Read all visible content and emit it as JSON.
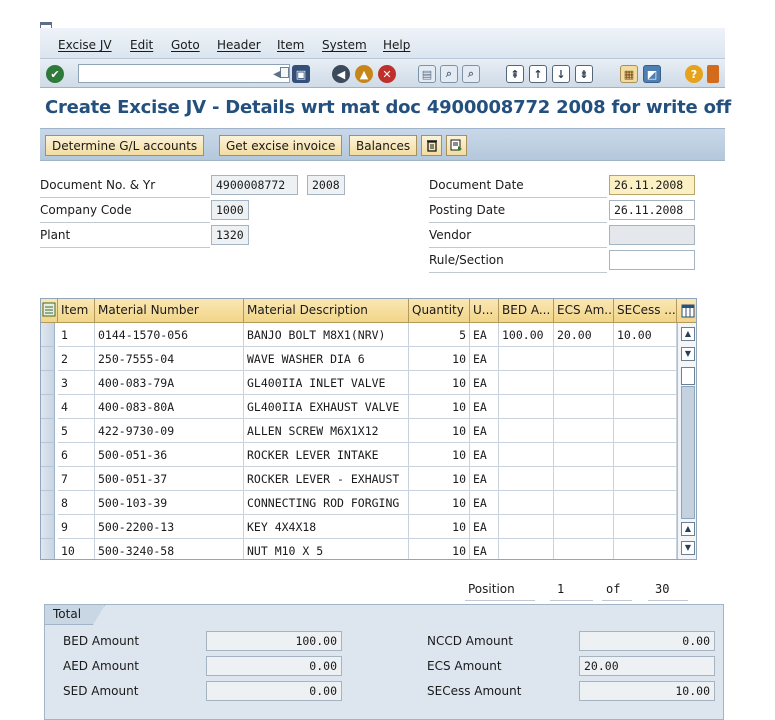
{
  "menu": [
    "Excise JV",
    "Edit",
    "Goto",
    "Header",
    "Item",
    "System",
    "Help"
  ],
  "title": "Create Excise JV - Details wrt mat doc 4900008772 2008 for write off",
  "app_buttons": {
    "determine": "Determine G/L accounts",
    "get_invoice": "Get excise invoice",
    "balances": "Balances"
  },
  "header": {
    "doc_no_label": "Document No. & Yr",
    "doc_no": "4900008772",
    "doc_year": "2008",
    "company_code_label": "Company Code",
    "company_code": "1000",
    "plant_label": "Plant",
    "plant": "1320",
    "doc_date_label": "Document Date",
    "doc_date": "26.11.2008",
    "posting_date_label": "Posting Date",
    "posting_date": "26.11.2008",
    "vendor_label": "Vendor",
    "vendor": "",
    "rule_label": "Rule/Section",
    "rule": ""
  },
  "table": {
    "columns": [
      "Item",
      "Material Number",
      "Material Description",
      "Quantity",
      "U...",
      "BED A...",
      "ECS Am...",
      "SECess ..."
    ],
    "rows": [
      {
        "item": "1",
        "mat": "0144-1570-056",
        "desc": "BANJO BOLT M8X1(NRV)",
        "qty": "5",
        "uom": "EA",
        "bed": "100.00",
        "ecs": "20.00",
        "secess": "10.00"
      },
      {
        "item": "2",
        "mat": "250-7555-04",
        "desc": "WAVE WASHER DIA 6",
        "qty": "10",
        "uom": "EA",
        "bed": "",
        "ecs": "",
        "secess": ""
      },
      {
        "item": "3",
        "mat": "400-083-79A",
        "desc": "GL400IIA  INLET VALVE",
        "qty": "10",
        "uom": "EA",
        "bed": "",
        "ecs": "",
        "secess": ""
      },
      {
        "item": "4",
        "mat": "400-083-80A",
        "desc": "GL400IIA EXHAUST VALVE",
        "qty": "10",
        "uom": "EA",
        "bed": "",
        "ecs": "",
        "secess": ""
      },
      {
        "item": "5",
        "mat": "422-9730-09",
        "desc": "ALLEN SCREW M6X1X12",
        "qty": "10",
        "uom": "EA",
        "bed": "",
        "ecs": "",
        "secess": ""
      },
      {
        "item": "6",
        "mat": "500-051-36",
        "desc": "ROCKER LEVER INTAKE",
        "qty": "10",
        "uom": "EA",
        "bed": "",
        "ecs": "",
        "secess": ""
      },
      {
        "item": "7",
        "mat": "500-051-37",
        "desc": "ROCKER LEVER - EXHAUST",
        "qty": "10",
        "uom": "EA",
        "bed": "",
        "ecs": "",
        "secess": ""
      },
      {
        "item": "8",
        "mat": "500-103-39",
        "desc": "CONNECTING ROD FORGING",
        "qty": "10",
        "uom": "EA",
        "bed": "",
        "ecs": "",
        "secess": ""
      },
      {
        "item": "9",
        "mat": "500-2200-13",
        "desc": "KEY 4X4X18",
        "qty": "10",
        "uom": "EA",
        "bed": "",
        "ecs": "",
        "secess": ""
      },
      {
        "item": "10",
        "mat": "500-3240-58",
        "desc": "NUT M10 X 5",
        "qty": "10",
        "uom": "EA",
        "bed": "",
        "ecs": "",
        "secess": ""
      }
    ]
  },
  "position": {
    "label": "Position",
    "current": "1",
    "of_label": "of",
    "total": "30"
  },
  "totals": {
    "tab_label": "Total",
    "bed_label": "BED Amount",
    "bed": "100.00",
    "aed_label": "AED Amount",
    "aed": "0.00",
    "sed_label": "SED Amount",
    "sed": "0.00",
    "nccd_label": "NCCD Amount",
    "nccd": "0.00",
    "ecs_label": "ECS Amount",
    "ecs": "20.00",
    "secess_label": "SECess Amount",
    "secess": "10.00"
  },
  "colors": {
    "title": "#24507e",
    "header_cell": "#f1d588",
    "button": "#f2dca0",
    "highlight_field": "#fbf0c4"
  }
}
